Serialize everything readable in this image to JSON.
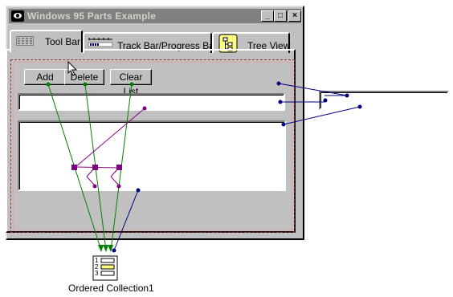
{
  "window": {
    "title": "Windows 95 Parts Example",
    "controls": {
      "minimize": "_",
      "maximize": "□",
      "close": "×"
    }
  },
  "tabs": [
    {
      "label": "Tool Bar",
      "icon": "toolbar-icon"
    },
    {
      "label": "Track Bar/Progress Bar",
      "icon": "trackbar-icon"
    },
    {
      "label": "Tree View",
      "icon": "treeview-icon"
    }
  ],
  "buttons": {
    "add": "Add",
    "delete": "Delete",
    "clear": "Clear List"
  },
  "inputs": {
    "text_value": "",
    "floating_value": ""
  },
  "collection": {
    "label": "Ordered Collection1",
    "icon": "ordered-collection-icon"
  },
  "colors": {
    "window_bg": "#c0c0c0",
    "titlebar": "#808080",
    "wire_green": "#008000",
    "wire_purple": "#800080",
    "wire_navy": "#000080"
  }
}
